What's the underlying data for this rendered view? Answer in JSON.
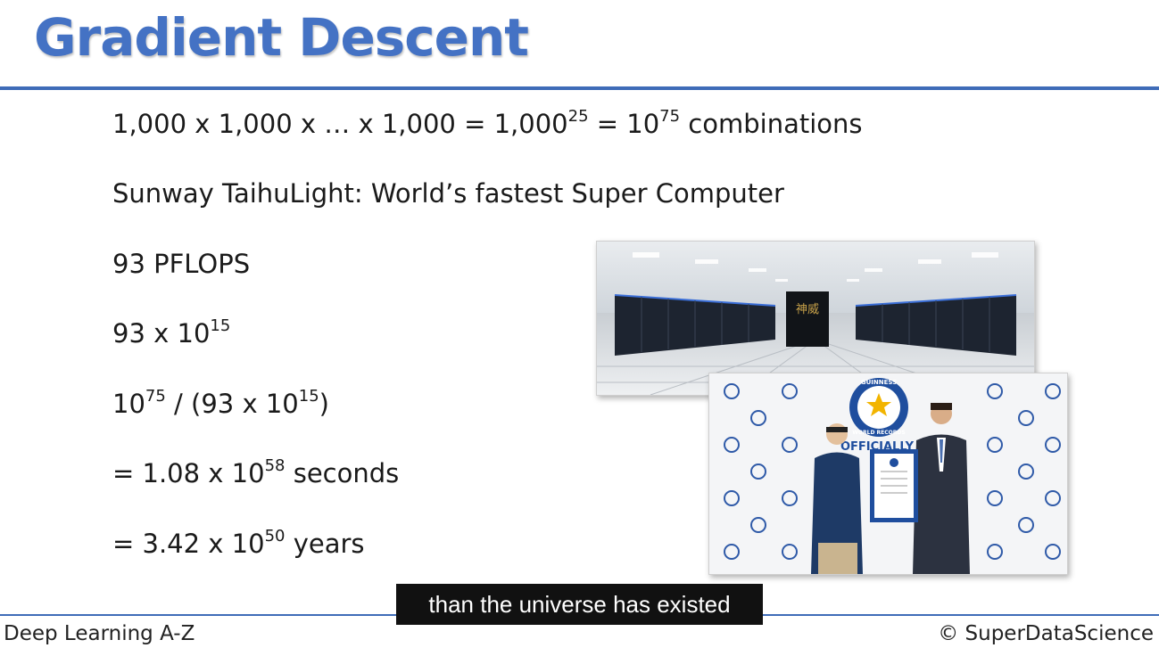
{
  "slide": {
    "title": "Gradient Descent",
    "line1": {
      "pre": "1,000 x 1,000 x … x 1,000 = 1,000",
      "sup1": "25",
      "mid": " = 10",
      "sup2": "75",
      "post": " combinations"
    },
    "line2": "Sunway TaihuLight: World’s fastest Super Computer",
    "line3": "93 PFLOPS",
    "line4": {
      "pre": "93 x 10",
      "sup": "15"
    },
    "line5": {
      "pre": "10",
      "sup1": "75",
      "mid": " / (93 x 10",
      "sup2": "15",
      "post": ")"
    },
    "line6": {
      "pre": "= 1.08 x 10",
      "sup": "58",
      "post": " seconds"
    },
    "line7": {
      "pre": "= 3.42 x 10",
      "sup": "50",
      "post": " years"
    }
  },
  "images": {
    "supercomputer_sign_glyphs": "神威",
    "guinness_logo_top": "GUINNESS",
    "guinness_logo_bottom": "WORLD RECORDS",
    "backdrop_text": "OFFICIALLY"
  },
  "footer": {
    "left": "Deep Learning A-Z",
    "right": "© SuperDataScience"
  },
  "caption": "than the universe has existed",
  "colors": {
    "accent": "#4472c4",
    "rule": "#3f6cb8"
  }
}
